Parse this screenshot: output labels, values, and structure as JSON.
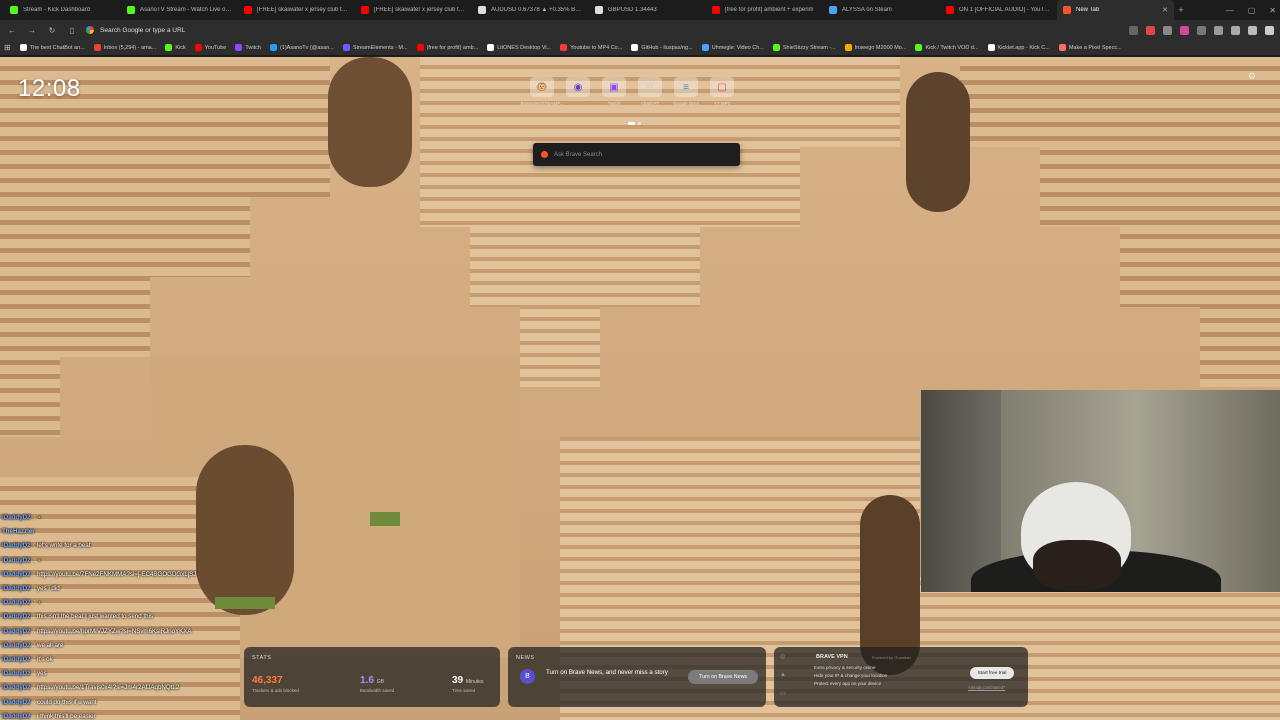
{
  "tabs": [
    {
      "label": "Stream - Kick Dashboard",
      "color": "#53fc18"
    },
    {
      "label": "AsanoTV Stream - Watch Live on Kick",
      "color": "#53fc18"
    },
    {
      "label": "[FREE] skaiwater x jersey club type",
      "color": "#ff0000"
    },
    {
      "label": "[FREE] skaiwater x jersey club type",
      "color": "#ff0000"
    },
    {
      "label": "AUDUSD 0.67378 ▲ +0.35% Buy/Sell",
      "color": "#dddddd"
    },
    {
      "label": "GBPUSD 1.34443",
      "color": "#dddddd"
    },
    {
      "label": "[free for profit] ambient + experim",
      "color": "#ff0000"
    },
    {
      "label": "ALYSSA on Steam",
      "color": "#4aa3ff"
    },
    {
      "label": "ON 1 [OFFICIAL AUDIO] - YouTube",
      "color": "#ff0000"
    },
    {
      "label": "New Tab",
      "color": "#fb542b"
    }
  ],
  "toolbar": {
    "omnibox_placeholder": "Search Google or type a URL"
  },
  "bookmarks": [
    {
      "label": "The best ChatBot an...",
      "color": "#ffffff"
    },
    {
      "label": "Inbox (5,294) - ama...",
      "color": "#ea4335"
    },
    {
      "label": "Kick",
      "color": "#53fc18"
    },
    {
      "label": "YouTube",
      "color": "#ff0000"
    },
    {
      "label": "Twitch",
      "color": "#9146ff"
    },
    {
      "label": "(1)AsanoTv (@asan...",
      "color": "#1da1f2"
    },
    {
      "label": "StreamElements - M...",
      "color": "#6b5cff"
    },
    {
      "label": "(free for profit) amb...",
      "color": "#ff0000"
    },
    {
      "label": "LitONES Desktop Vi...",
      "color": "#ffffff"
    },
    {
      "label": "Youtube to MP4 Co...",
      "color": "#ff3b3b"
    },
    {
      "label": "GitHub - iluspas/ng...",
      "color": "#ffffff"
    },
    {
      "label": "Uhmegle: Video Ch...",
      "color": "#4aa3ff"
    },
    {
      "label": "ShieStizzy Stream -...",
      "color": "#53fc18"
    },
    {
      "label": "Inseego M2000 Mo...",
      "color": "#ffaa00"
    },
    {
      "label": "Kick / Twitch VOD d...",
      "color": "#53fc18"
    },
    {
      "label": "Kicklet.app - Kick C...",
      "color": "#ffffff"
    },
    {
      "label": "Make a Pixel Specc...",
      "color": "#ff6b6b"
    }
  ],
  "ntp": {
    "clock": "12:08",
    "tiles": [
      {
        "name": "Bitwarden/STEAMP...",
        "glyph": "🐵",
        "color": "#e8d3a8"
      },
      {
        "name": "",
        "glyph": "◉",
        "color": "#6a3cc9"
      },
      {
        "name": "Twitch",
        "glyph": "▣",
        "color": "#9146ff"
      },
      {
        "name": "ChatGPT",
        "glyph": "✲",
        "color": "#cfcfcf"
      },
      {
        "name": "Google Docs",
        "glyph": "≡",
        "color": "#4285f4"
      },
      {
        "name": "YT MP3",
        "glyph": "▢",
        "color": "#e04848"
      }
    ],
    "search_placeholder": "Ask Brave Search"
  },
  "chat": [
    {
      "user": "iDaddyD2",
      "msg": ":",
      "emote": true
    },
    {
      "user": "TheHazzler",
      "msg": ""
    },
    {
      "user": "iDaddyD2",
      "msg": ": let's write for a beat"
    },
    {
      "user": "iDaddyD2",
      "msg": ":",
      "emote": true
    },
    {
      "user": "iDaddyD2",
      "msg": ": https://youtu.be/7FNe2FNKMMA?si=j-EC4BGOGDGxLjSJ"
    },
    {
      "user": "iDaddyD2",
      "msg": ": yes i did"
    },
    {
      "user": "iDaddyD2",
      "msg": ":",
      "emote": true
    },
    {
      "user": "iDaddyD2",
      "msg": ": this isn't the beat I just wanted to send this"
    },
    {
      "user": "iDaddyD2",
      "msg": ": https://youtu.be/hprMIVJZYZw?si=NSvm6KslRJnoYKXA"
    },
    {
      "user": "iDaddyD2",
      "msg": ": we all are"
    },
    {
      "user": "iDaddyD2",
      "msg": ": it's ok"
    },
    {
      "user": "iDaddyD2",
      "msg": ": yes"
    },
    {
      "user": "iDaddyD2",
      "msg": ": https://youtu.be/1Travis0x4I?si=Jm4r2AfJAqbNQtL2"
    },
    {
      "user": "iDaddyD2",
      "msg": ": could do this if u want"
    },
    {
      "user": "iDaddyD2",
      "msg": ": i think this'll be easier"
    }
  ],
  "stats": {
    "title": "STATS",
    "trackers_value": "46,337",
    "trackers_label": "Trackers & ads blocked",
    "bandwidth_value": "1.6",
    "bandwidth_unit": "GB",
    "bandwidth_label": "Bandwidth saved",
    "time_value": "39",
    "time_unit": "Minutes",
    "time_label": "Time saved",
    "accent": "#ff7a3d"
  },
  "news": {
    "title": "NEWS",
    "text": "Turn on Brave News, and never miss a story",
    "button": "Turn on Brave News"
  },
  "vpn": {
    "title": "BRAVE VPN",
    "powered": "Powered by Guardian",
    "features": [
      "Extra privacy & security online",
      "Hide your IP & change your location",
      "Protect every app on your device"
    ],
    "button": "Start free trial",
    "link": "Already purchased?"
  }
}
